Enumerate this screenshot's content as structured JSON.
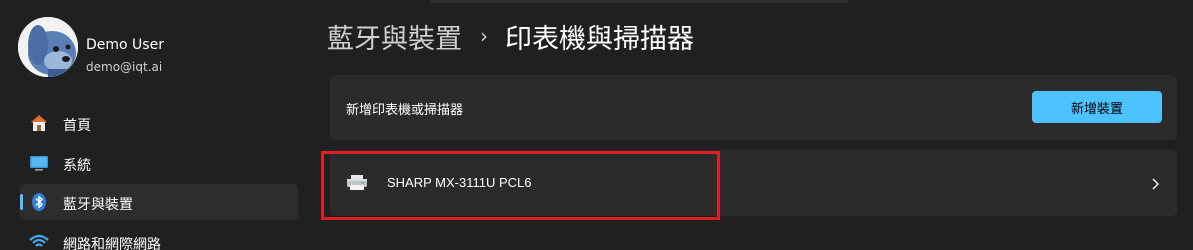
{
  "user": {
    "name": "Demo User",
    "email": "demo@iqt.ai"
  },
  "sidebar": {
    "items": [
      {
        "label": "首頁",
        "icon": "home-icon"
      },
      {
        "label": "系統",
        "icon": "monitor-icon"
      },
      {
        "label": "藍牙與裝置",
        "icon": "bluetooth-icon",
        "active": true
      },
      {
        "label": "網路和網際網路",
        "icon": "wifi-icon"
      }
    ]
  },
  "breadcrumb": {
    "parent": "藍牙與裝置",
    "separator": "›",
    "current": "印表機與掃描器"
  },
  "add_printer": {
    "label": "新增印表機或掃描器",
    "button_label": "新增裝置"
  },
  "printers": [
    {
      "name": "SHARP MX-3111U PCL6",
      "icon": "printer-icon"
    }
  ],
  "colors": {
    "accent": "#4cc2ff",
    "background": "#202020",
    "card": "#2b2b2b",
    "highlight": "#e02020"
  }
}
